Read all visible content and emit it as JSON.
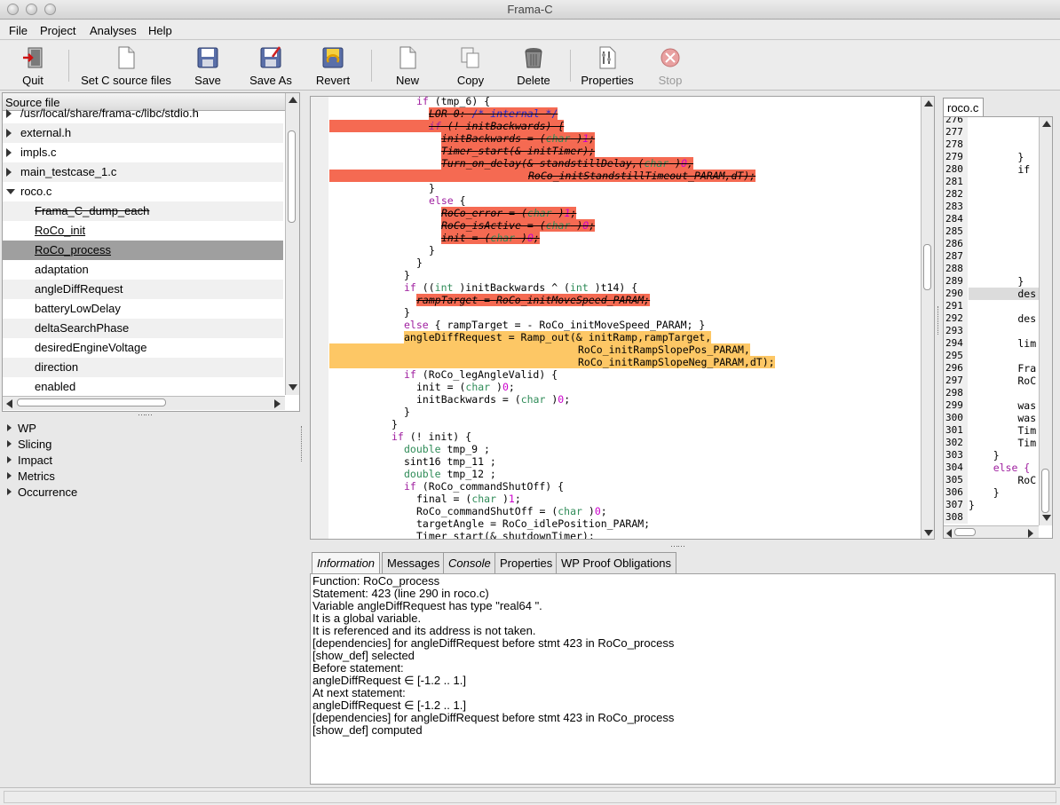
{
  "window": {
    "title": "Frama-C"
  },
  "menu": [
    "File",
    "Project",
    "Analyses",
    "Help"
  ],
  "toolbar": {
    "quit": "Quit",
    "set_sources": "Set C source files",
    "save": "Save",
    "save_as": "Save As",
    "revert": "Revert",
    "new": "New",
    "copy": "Copy",
    "delete": "Delete",
    "properties": "Properties",
    "stop": "Stop"
  },
  "tree": {
    "header": "Source file",
    "rows": [
      {
        "label": "/usr/local/share/frama-c/libc/stdio.h",
        "type": "file",
        "expanded": false
      },
      {
        "label": "external.h",
        "type": "file",
        "expanded": false
      },
      {
        "label": "impls.c",
        "type": "file",
        "expanded": false
      },
      {
        "label": "main_testcase_1.c",
        "type": "file",
        "expanded": false
      },
      {
        "label": "roco.c",
        "type": "file",
        "expanded": true
      },
      {
        "label": "Frama_C_dump_each",
        "type": "func",
        "style": "strike"
      },
      {
        "label": "RoCo_init",
        "type": "func",
        "style": "underline"
      },
      {
        "label": "RoCo_process",
        "type": "func",
        "style": "underline",
        "selected": true
      },
      {
        "label": "adaptation",
        "type": "global"
      },
      {
        "label": "angleDiffRequest",
        "type": "global"
      },
      {
        "label": "batteryLowDelay",
        "type": "global"
      },
      {
        "label": "deltaSearchPhase",
        "type": "global"
      },
      {
        "label": "desiredEngineVoltage",
        "type": "global"
      },
      {
        "label": "direction",
        "type": "global"
      },
      {
        "label": "enabled",
        "type": "global"
      }
    ]
  },
  "plugins": [
    "WP",
    "Slicing",
    "Impact",
    "Metrics",
    "Occurrence"
  ],
  "code": {
    "lines": [
      {
        "indent": 14,
        "segs": [
          [
            "kw",
            "if"
          ],
          [
            "t",
            " (tmp_6) {"
          ]
        ]
      },
      {
        "indent": 16,
        "hl": "red",
        "segs": [
          [
            "t",
            "LOR 0: "
          ],
          [
            "com",
            "/* internal */"
          ]
        ]
      },
      {
        "indent": 16,
        "hl": "red",
        "full": true,
        "segs": [
          [
            "kw",
            "if"
          ],
          [
            "t",
            " (! initBackwards) {"
          ]
        ]
      },
      {
        "indent": 18,
        "hl": "red",
        "segs": [
          [
            "t",
            "initBackwards = ("
          ],
          [
            "ty",
            "char"
          ],
          [
            "t",
            " )"
          ],
          [
            "num",
            "1"
          ],
          [
            "t",
            ";"
          ]
        ]
      },
      {
        "indent": 18,
        "hl": "red",
        "segs": [
          [
            "t",
            "Timer_start(& initTimer);"
          ]
        ]
      },
      {
        "indent": 18,
        "hl": "red",
        "segs": [
          [
            "t",
            "Turn_on_delay(& standstillDelay,("
          ],
          [
            "ty",
            "char"
          ],
          [
            "t",
            " )"
          ],
          [
            "num",
            "0"
          ],
          [
            "t",
            ","
          ]
        ]
      },
      {
        "indent": 32,
        "hl": "red",
        "full": true,
        "segs": [
          [
            "t",
            "RoCo_initStandstillTimeout_PARAM,dT);"
          ]
        ]
      },
      {
        "indent": 16,
        "segs": [
          [
            "t",
            "}"
          ]
        ]
      },
      {
        "indent": 16,
        "segs": [
          [
            "kw",
            "else"
          ],
          [
            "t",
            " {"
          ]
        ]
      },
      {
        "indent": 18,
        "hl": "red",
        "segs": [
          [
            "t",
            "RoCo_error = ("
          ],
          [
            "ty",
            "char"
          ],
          [
            "t",
            " )"
          ],
          [
            "num",
            "1"
          ],
          [
            "t",
            ";"
          ]
        ]
      },
      {
        "indent": 18,
        "hl": "red",
        "segs": [
          [
            "t",
            "RoCo_isActive = ("
          ],
          [
            "ty",
            "char"
          ],
          [
            "t",
            " )"
          ],
          [
            "num",
            "0"
          ],
          [
            "t",
            ";"
          ]
        ]
      },
      {
        "indent": 18,
        "hl": "red",
        "segs": [
          [
            "t",
            "init = ("
          ],
          [
            "ty",
            "char"
          ],
          [
            "t",
            " )"
          ],
          [
            "num",
            "0"
          ],
          [
            "t",
            ";"
          ]
        ]
      },
      {
        "indent": 16,
        "segs": [
          [
            "t",
            "}"
          ]
        ]
      },
      {
        "indent": 14,
        "segs": [
          [
            "t",
            "}"
          ]
        ]
      },
      {
        "indent": 12,
        "segs": [
          [
            "t",
            "}"
          ]
        ]
      },
      {
        "indent": 12,
        "segs": [
          [
            "kw",
            "if"
          ],
          [
            "t",
            " (("
          ],
          [
            "ty",
            "int"
          ],
          [
            "t",
            " )initBackwards ^ ("
          ],
          [
            "ty",
            "int"
          ],
          [
            "t",
            " )t14) {"
          ]
        ]
      },
      {
        "indent": 14,
        "hl": "red",
        "segs": [
          [
            "t",
            "rampTarget = RoCo_initMoveSpeed_PARAM;"
          ]
        ]
      },
      {
        "indent": 12,
        "segs": [
          [
            "t",
            "}"
          ]
        ]
      },
      {
        "indent": 12,
        "segs": [
          [
            "kw",
            "else"
          ],
          [
            "t",
            " { rampTarget = - RoCo_initMoveSpeed_PARAM; }"
          ]
        ]
      },
      {
        "indent": 12,
        "hl": "orange",
        "segs": [
          [
            "t",
            "angleDiffRequest = Ramp_out(& initRamp,rampTarget,"
          ]
        ]
      },
      {
        "indent": 40,
        "hl": "orange",
        "full": true,
        "segs": [
          [
            "t",
            "RoCo_initRampSlopePos_PARAM,"
          ]
        ]
      },
      {
        "indent": 40,
        "hl": "orange",
        "full": true,
        "segs": [
          [
            "t",
            "RoCo_initRampSlopeNeg_PARAM,dT);"
          ]
        ]
      },
      {
        "indent": 12,
        "segs": [
          [
            "kw",
            "if"
          ],
          [
            "t",
            " (RoCo_legAngleValid) {"
          ]
        ]
      },
      {
        "indent": 14,
        "segs": [
          [
            "t",
            "init = ("
          ],
          [
            "ty",
            "char"
          ],
          [
            "t",
            " )"
          ],
          [
            "num",
            "0"
          ],
          [
            "t",
            ";"
          ]
        ]
      },
      {
        "indent": 14,
        "segs": [
          [
            "t",
            "initBackwards = ("
          ],
          [
            "ty",
            "char"
          ],
          [
            "t",
            " )"
          ],
          [
            "num",
            "0"
          ],
          [
            "t",
            ";"
          ]
        ]
      },
      {
        "indent": 12,
        "segs": [
          [
            "t",
            "}"
          ]
        ]
      },
      {
        "indent": 10,
        "segs": [
          [
            "t",
            "}"
          ]
        ]
      },
      {
        "indent": 10,
        "segs": [
          [
            "kw",
            "if"
          ],
          [
            "t",
            " (! init) {"
          ]
        ]
      },
      {
        "indent": 12,
        "segs": [
          [
            "ty",
            "double"
          ],
          [
            "t",
            " tmp_9 ;"
          ]
        ]
      },
      {
        "indent": 12,
        "segs": [
          [
            "t",
            "sint16 tmp_11 ;"
          ]
        ]
      },
      {
        "indent": 12,
        "segs": [
          [
            "ty",
            "double"
          ],
          [
            "t",
            " tmp_12 ;"
          ]
        ]
      },
      {
        "indent": 12,
        "segs": [
          [
            "kw",
            "if"
          ],
          [
            "t",
            " (RoCo_commandShutOff) {"
          ]
        ]
      },
      {
        "indent": 14,
        "segs": [
          [
            "t",
            "final = ("
          ],
          [
            "ty",
            "char"
          ],
          [
            "t",
            " )"
          ],
          [
            "num",
            "1"
          ],
          [
            "t",
            ";"
          ]
        ]
      },
      {
        "indent": 14,
        "segs": [
          [
            "t",
            "RoCo_commandShutOff = ("
          ],
          [
            "ty",
            "char"
          ],
          [
            "t",
            " )"
          ],
          [
            "num",
            "0"
          ],
          [
            "t",
            ";"
          ]
        ]
      },
      {
        "indent": 14,
        "segs": [
          [
            "t",
            "targetAngle = RoCo_idlePosition_PARAM;"
          ]
        ]
      },
      {
        "indent": 14,
        "segs": [
          [
            "t",
            "Timer_start(& shutdownTimer);"
          ]
        ]
      }
    ]
  },
  "source_view": {
    "tab": "roco.c",
    "lines": [
      {
        "n": "276",
        "t": ""
      },
      {
        "n": "277",
        "t": ""
      },
      {
        "n": "278",
        "t": ""
      },
      {
        "n": "279",
        "t": "        }"
      },
      {
        "n": "280",
        "t": "        if"
      },
      {
        "n": "281",
        "t": ""
      },
      {
        "n": "282",
        "t": ""
      },
      {
        "n": "283",
        "t": ""
      },
      {
        "n": "284",
        "t": ""
      },
      {
        "n": "285",
        "t": ""
      },
      {
        "n": "286",
        "t": ""
      },
      {
        "n": "287",
        "t": ""
      },
      {
        "n": "288",
        "t": ""
      },
      {
        "n": "289",
        "t": "        }"
      },
      {
        "n": "290",
        "t": "        des",
        "hl": true
      },
      {
        "n": "291",
        "t": ""
      },
      {
        "n": "292",
        "t": "        des"
      },
      {
        "n": "293",
        "t": ""
      },
      {
        "n": "294",
        "t": "        lim"
      },
      {
        "n": "295",
        "t": ""
      },
      {
        "n": "296",
        "t": "        Fra"
      },
      {
        "n": "297",
        "t": "        RoC"
      },
      {
        "n": "298",
        "t": ""
      },
      {
        "n": "299",
        "t": "        was"
      },
      {
        "n": "300",
        "t": "        was"
      },
      {
        "n": "301",
        "t": "        Tim"
      },
      {
        "n": "302",
        "t": "        Tim"
      },
      {
        "n": "303",
        "t": "    }"
      },
      {
        "n": "304",
        "t": "    else {",
        "kw": true
      },
      {
        "n": "305",
        "t": "        RoC"
      },
      {
        "n": "306",
        "t": "    }"
      },
      {
        "n": "307",
        "t": "}"
      },
      {
        "n": "308",
        "t": ""
      }
    ]
  },
  "bottom_tabs": [
    "Information",
    "Messages",
    "Console",
    "Properties",
    "WP Proof Obligations"
  ],
  "info": [
    "Function: RoCo_process",
    "Statement: 423 (line 290 in roco.c)",
    "Variable angleDiffRequest has type \"real64 \".",
    "It is a global variable.",
    "It is referenced and its address is not taken.",
    "[dependencies] for angleDiffRequest before stmt 423 in RoCo_process",
    "[show_def] selected",
    "Before statement:",
    "angleDiffRequest ∈ [-1.2 .. 1.]",
    "At next statement:",
    "angleDiffRequest ∈ [-1.2 .. 1.]",
    "[dependencies] for angleDiffRequest before stmt 423 in RoCo_process",
    "[show_def] computed"
  ]
}
